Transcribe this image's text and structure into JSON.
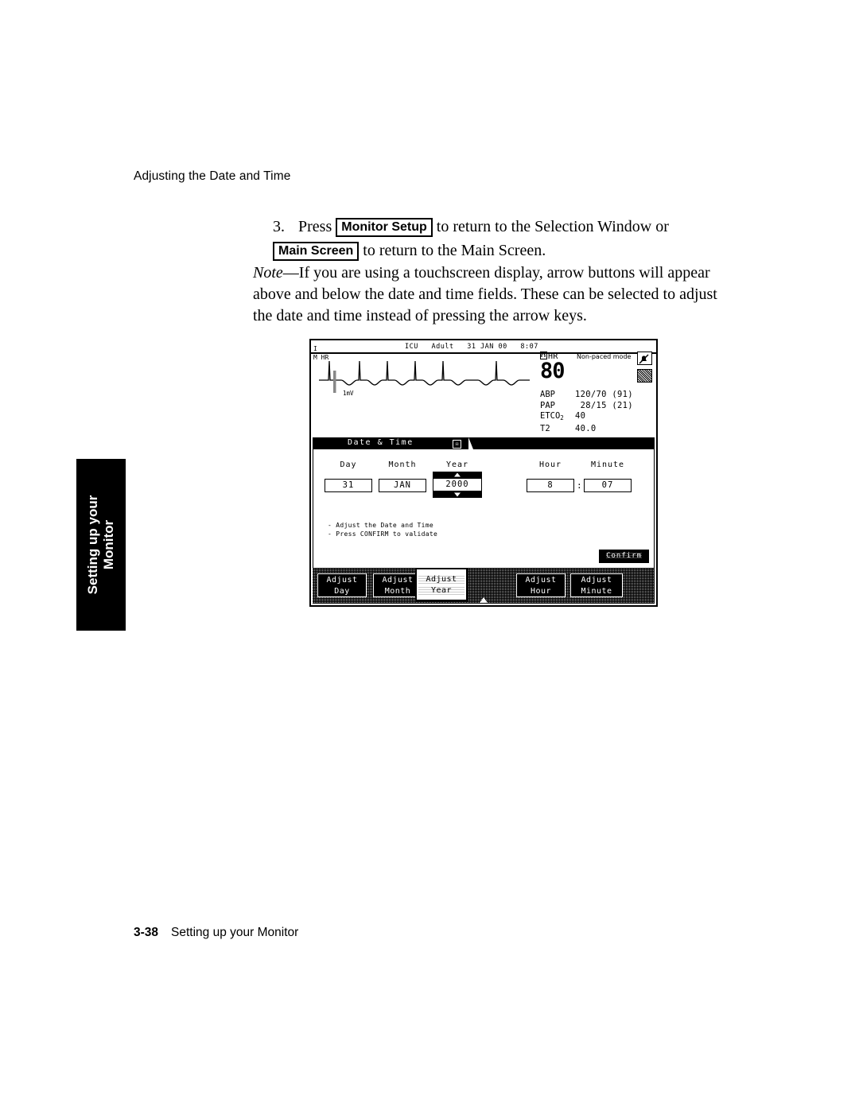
{
  "page": {
    "running_head": "Adjusting the Date and Time",
    "footer_page_number": "3-38",
    "footer_title": "Setting up your Monitor",
    "side_tab_label": "Setting up your\nMonitor"
  },
  "step": {
    "number": "3.",
    "press_word": "Press",
    "key_monitor_setup": "Monitor Setup",
    "text_after_key1": "to return to the Selection Window or",
    "key_main_screen": "Main Screen",
    "text_after_key2": "to return to the Main Screen."
  },
  "note": {
    "label": "Note",
    "dash": "—",
    "text": "If you are using a touchscreen display, arrow buttons will appear above and below the date and time fields. These can be selected to adjust the date and time instead of pressing the arrow keys."
  },
  "monitor": {
    "header": {
      "unit": "ICU",
      "patient_type": "Adult",
      "date": "31 JAN 00",
      "time": "8:07"
    },
    "ecg": {
      "lead_label_top": "I",
      "lead_label_bottom": "M  HR",
      "calibration": "1mV"
    },
    "numerics": {
      "hr_label": "HR",
      "hr_value": "80",
      "paced_mode": "Non-paced mode",
      "rows": [
        {
          "label": "ABP",
          "value": "120/70 (91)"
        },
        {
          "label": "PAP",
          "value": " 28/15 (21)"
        },
        {
          "label": "ETCO",
          "sub": "2",
          "value": "40"
        },
        {
          "label": "T2",
          "value": "40.0"
        }
      ]
    },
    "icons": {
      "alarm_off": "alarm-silenced-bell-icon",
      "hatched": "hatched-pattern-icon"
    },
    "dialog": {
      "title": "Date & Time",
      "close_glyph": "☒",
      "fields": [
        {
          "caption": "Day",
          "value": "31"
        },
        {
          "caption": "Month",
          "value": "JAN"
        },
        {
          "caption": "Year",
          "value": "2000"
        },
        {
          "caption": "Hour",
          "value": "8"
        },
        {
          "caption": "Minute",
          "value": "07"
        }
      ],
      "time_separator": ":",
      "hints": [
        "- Adjust the Date and Time",
        "- Press CONFIRM to validate"
      ],
      "confirm_label": "Confirm"
    },
    "softkeys": [
      {
        "line1": "Adjust",
        "line2": "Day",
        "selected": false
      },
      {
        "line1": "Adjust",
        "line2": "Month",
        "selected": false
      },
      {
        "line1": "Adjust",
        "line2": "Year",
        "selected": true
      },
      {
        "line1": "Adjust",
        "line2": "Hour",
        "selected": false
      },
      {
        "line1": "Adjust",
        "line2": "Minute",
        "selected": false
      }
    ]
  }
}
